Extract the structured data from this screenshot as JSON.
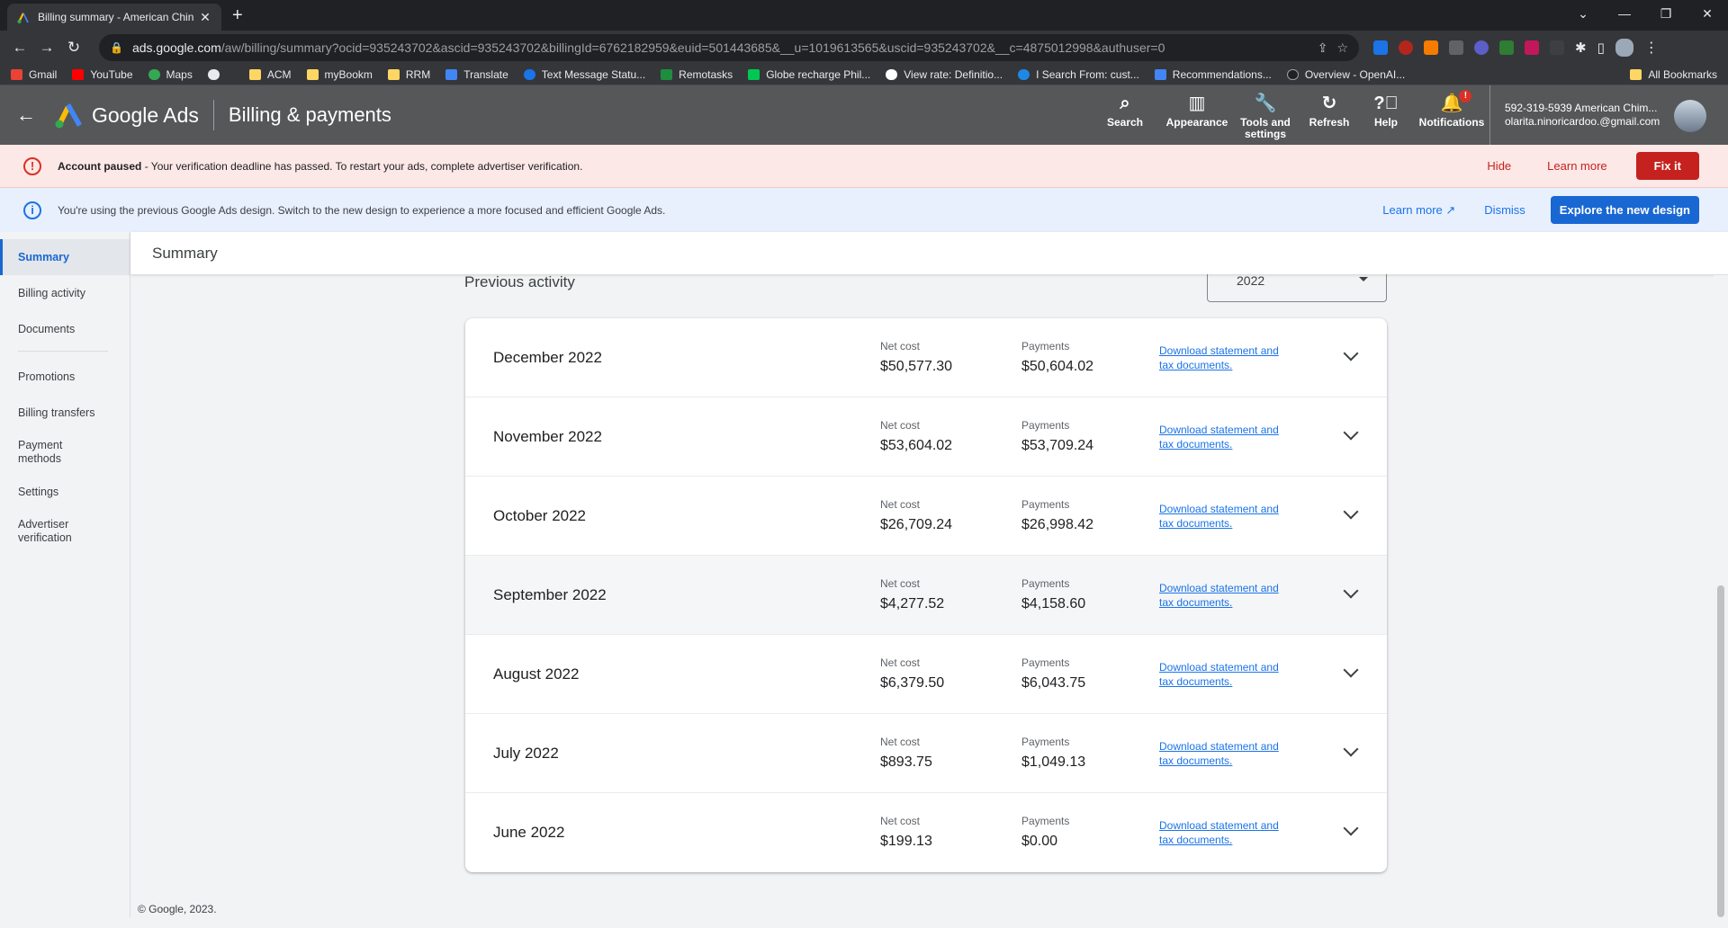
{
  "browser": {
    "tab_title": "Billing summary - American Chin",
    "url_host": "ads.google.com",
    "url_path": "/aw/billing/summary?ocid=935243702&ascid=935243702&billingId=6762182959&euid=501443685&__u=1019613565&uscid=935243702&__c=4875012998&authuser=0",
    "bookmarks": [
      "Gmail",
      "YouTube",
      "Maps",
      "ACM",
      "myBookm",
      "RRM",
      "Translate",
      "Text Message Statu...",
      "Remotasks",
      "Globe recharge Phil...",
      "View rate: Definitio...",
      "I Search From: cust...",
      "Recommendations...",
      "Overview - OpenAI..."
    ],
    "all_bookmarks": "All Bookmarks"
  },
  "header": {
    "brand": "Google Ads",
    "page_title": "Billing & payments",
    "actions": {
      "search": "Search",
      "appearance": "Appearance",
      "tools": "Tools and settings",
      "refresh": "Refresh",
      "help": "Help",
      "notifications": "Notifications",
      "notification_badge": "!"
    },
    "account_name": "592-319-5939 American Chim...",
    "account_email": "olarita.ninoricardoo.@gmail.com"
  },
  "alert": {
    "title": "Account paused",
    "message": " - Your verification deadline has passed. To restart your ads, complete advertiser verification.",
    "hide": "Hide",
    "learn_more": "Learn more",
    "fix_it": "Fix it"
  },
  "info": {
    "message": "You're using the previous Google Ads design. Switch to the new design to experience a more focused and efficient Google Ads.",
    "learn_more": "Learn more",
    "dismiss": "Dismiss",
    "explore": "Explore the new design"
  },
  "sidenav": {
    "items": [
      "Summary",
      "Billing activity",
      "Documents",
      "Promotions",
      "Billing transfers",
      "Payment methods",
      "Settings",
      "Advertiser verification"
    ]
  },
  "main": {
    "subheader": "Summary",
    "section_title": "Previous activity",
    "year": "2022",
    "net_cost_label": "Net cost",
    "payments_label": "Payments",
    "download_label": "Download statement and tax documents.",
    "rows": [
      {
        "month": "December 2022",
        "net_cost": "$50,577.30",
        "payments": "$50,604.02"
      },
      {
        "month": "November 2022",
        "net_cost": "$53,604.02",
        "payments": "$53,709.24"
      },
      {
        "month": "October 2022",
        "net_cost": "$26,709.24",
        "payments": "$26,998.42"
      },
      {
        "month": "September 2022",
        "net_cost": "$4,277.52",
        "payments": "$4,158.60"
      },
      {
        "month": "August 2022",
        "net_cost": "$6,379.50",
        "payments": "$6,043.75"
      },
      {
        "month": "July 2022",
        "net_cost": "$893.75",
        "payments": "$1,049.13"
      },
      {
        "month": "June 2022",
        "net_cost": "$199.13",
        "payments": "$0.00"
      }
    ]
  },
  "footer": "© Google, 2023.",
  "colors": {
    "primary_blue": "#1967d2",
    "alert_red": "#c5221f",
    "alert_bg": "#fce8e6",
    "info_bg": "#e8f0fe"
  }
}
